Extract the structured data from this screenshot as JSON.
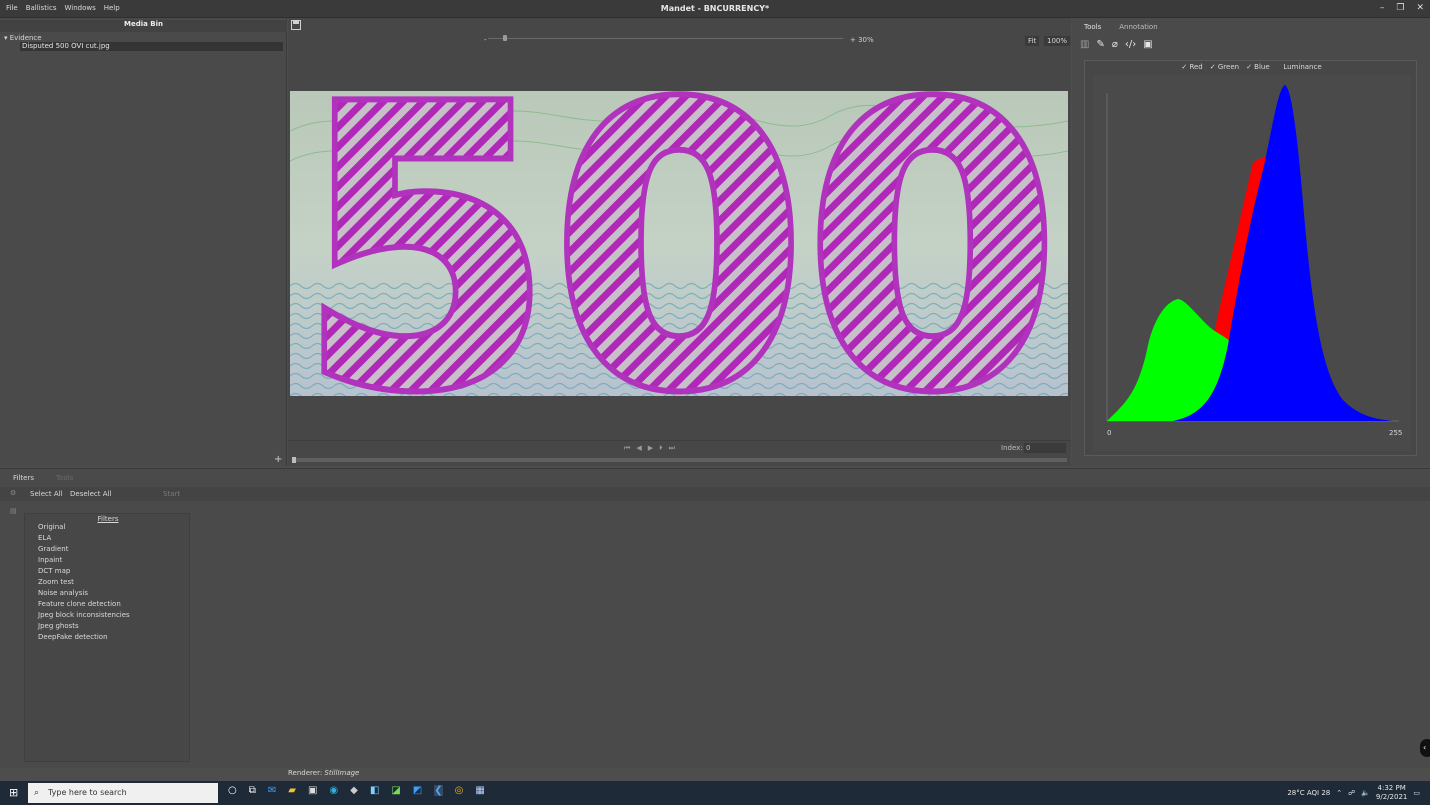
{
  "app": {
    "title": "Mandet - BNCURRENCY*",
    "menu": [
      "File",
      "Ballistics",
      "Windows",
      "Help"
    ],
    "window_controls": [
      "–",
      "❐",
      "✕"
    ]
  },
  "media_bin": {
    "title": "Media Bin",
    "tree_root": "▾  Evidence",
    "file": "Disputed 500 OVI cut.jpg",
    "add": "+"
  },
  "viewer": {
    "zoom_left": "-",
    "zoom_right": "+ 30%",
    "fit": "Fit",
    "hundred": "100%",
    "index_label": "Index:",
    "index_value": "0",
    "image_text": "500",
    "zoom_level": 0.04
  },
  "tools": {
    "tab_tools": "Tools",
    "tab_annotation": "Annotation",
    "icons": [
      "histogram-icon",
      "eyedropper-icon",
      "ruler-icon",
      "code-icon",
      "chart-icon"
    ],
    "histogram": {
      "legend": [
        {
          "label": "Red",
          "checked": true
        },
        {
          "label": "Green",
          "checked": true
        },
        {
          "label": "Blue",
          "checked": true
        },
        {
          "label": "Luminance",
          "checked": false
        }
      ],
      "x_min": "0",
      "x_max": "255"
    }
  },
  "filters": {
    "tab_filters": "Filters",
    "tab_other": "Tools",
    "select_all": "Select All",
    "deselect_all": "Deselect All",
    "start": "Start",
    "list_title": "Filters",
    "items": [
      "Original",
      "ELA",
      "Gradient",
      "Inpaint",
      "DCT map",
      "Zoom test",
      "Noise analysis",
      "Feature clone detection",
      "Jpeg block inconsistencies",
      "Jpeg ghosts",
      "DeepFake detection"
    ]
  },
  "status": {
    "renderer_label": "Renderer:",
    "renderer_value": "StillImage"
  },
  "taskbar": {
    "search_placeholder": "Type here to search",
    "weather": "28°C  AQI 28",
    "time": "4:32 PM",
    "date": "9/2/2021"
  },
  "colors": {
    "red": "#ff0000",
    "green": "#00ff00",
    "blue": "#0000ff",
    "accent": "#e040e0"
  }
}
